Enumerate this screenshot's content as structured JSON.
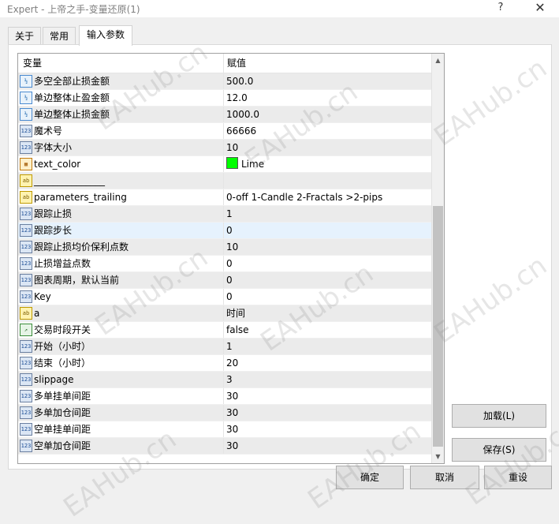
{
  "window": {
    "title": "Expert - 上帝之手-变量还原(1)",
    "help_glyph": "?",
    "close_glyph": "✕"
  },
  "tabs": [
    {
      "label": "关于"
    },
    {
      "label": "常用"
    },
    {
      "label": "输入参数",
      "active": true
    }
  ],
  "grid": {
    "headers": {
      "variable": "变量",
      "value": "赋值"
    },
    "rows": [
      {
        "icon": "double",
        "name": "多空全部止损金额",
        "value": "500.0"
      },
      {
        "icon": "double",
        "name": "单边整体止盈金额",
        "value": "12.0"
      },
      {
        "icon": "double",
        "name": "单边整体止损金额",
        "value": "1000.0"
      },
      {
        "icon": "int",
        "name": "魔术号",
        "value": "66666"
      },
      {
        "icon": "int",
        "name": "字体大小",
        "value": "10"
      },
      {
        "icon": "color",
        "name": "text_color",
        "value": "Lime",
        "swatch": "#00ff00"
      },
      {
        "icon": "string",
        "name": "_______________",
        "value": ""
      },
      {
        "icon": "string",
        "name": "parameters_trailing",
        "value": "0-off  1-Candle  2-Fractals  >2-pips"
      },
      {
        "icon": "int",
        "name": "跟踪止损",
        "value": "1"
      },
      {
        "icon": "int",
        "name": "跟踪步长",
        "value": "0",
        "selected": true
      },
      {
        "icon": "int",
        "name": "跟踪止损均价保利点数",
        "value": "10"
      },
      {
        "icon": "int",
        "name": "止损增益点数",
        "value": "0"
      },
      {
        "icon": "int",
        "name": "图表周期，默认当前",
        "value": "0"
      },
      {
        "icon": "int",
        "name": "Key",
        "value": "0"
      },
      {
        "icon": "string",
        "name": "a",
        "value": "时间"
      },
      {
        "icon": "bool",
        "name": "交易时段开关",
        "value": "false"
      },
      {
        "icon": "int",
        "name": "开始（小时）",
        "value": "1"
      },
      {
        "icon": "int",
        "name": "结束（小时）",
        "value": "20"
      },
      {
        "icon": "int",
        "name": "slippage",
        "value": "3"
      },
      {
        "icon": "int",
        "name": "多单挂单间距",
        "value": "30"
      },
      {
        "icon": "int",
        "name": "多单加仓间距",
        "value": "30"
      },
      {
        "icon": "int",
        "name": "空单挂单间距",
        "value": "30"
      },
      {
        "icon": "int",
        "name": "空单加仓间距",
        "value": "30"
      }
    ]
  },
  "side_buttons": {
    "load": "加载(L)",
    "save": "保存(S)"
  },
  "bottom_buttons": {
    "ok": "确定",
    "cancel": "取消",
    "reset": "重设"
  },
  "watermark_text": "EAHub.cn",
  "icon_text": {
    "double": "½",
    "int": "123",
    "color": "▦",
    "string": "ab",
    "bool": "↗"
  }
}
